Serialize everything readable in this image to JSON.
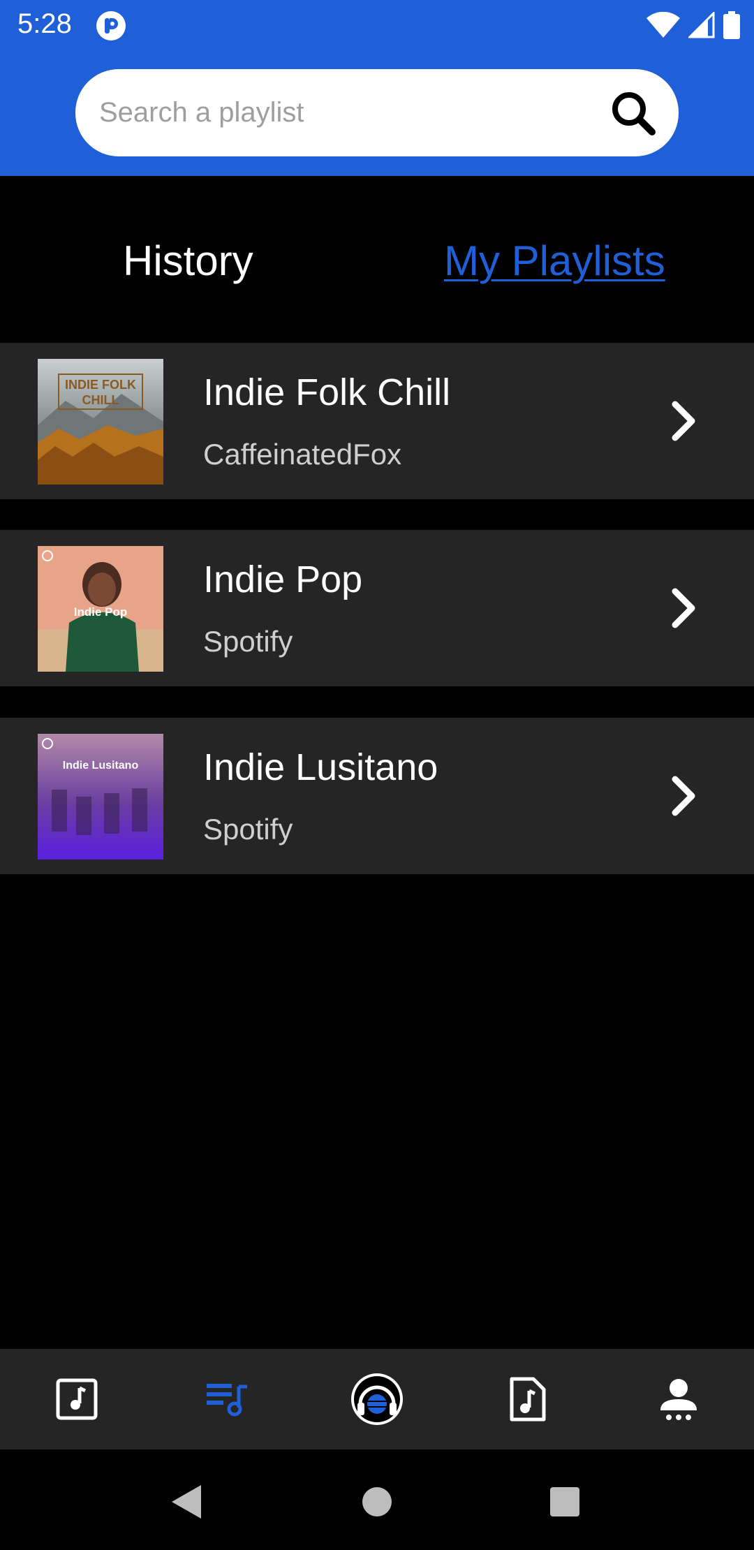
{
  "status_bar": {
    "time": "5:28"
  },
  "search": {
    "placeholder": "Search a playlist",
    "value": ""
  },
  "tabs": {
    "history": "History",
    "my_playlists": "My Playlists",
    "active": "my_playlists"
  },
  "playlists": [
    {
      "title": "Indie Folk Chill",
      "owner": "CaffeinatedFox",
      "cover_text": "INDIE FOLK CHILL"
    },
    {
      "title": "Indie Pop",
      "owner": "Spotify",
      "cover_text": "Indie Pop"
    },
    {
      "title": "Indie Lusitano",
      "owner": "Spotify",
      "cover_text": "Indie Lusitano"
    }
  ],
  "bottom_nav": {
    "items": [
      "music-square-icon",
      "playlist-icon",
      "headphones-globe-icon",
      "music-file-icon",
      "user-icon"
    ],
    "active": "playlist-icon"
  },
  "colors": {
    "header": "#1f5fd8",
    "accent": "#1f5fd8",
    "row_bg": "#252525",
    "bg": "#000000"
  }
}
